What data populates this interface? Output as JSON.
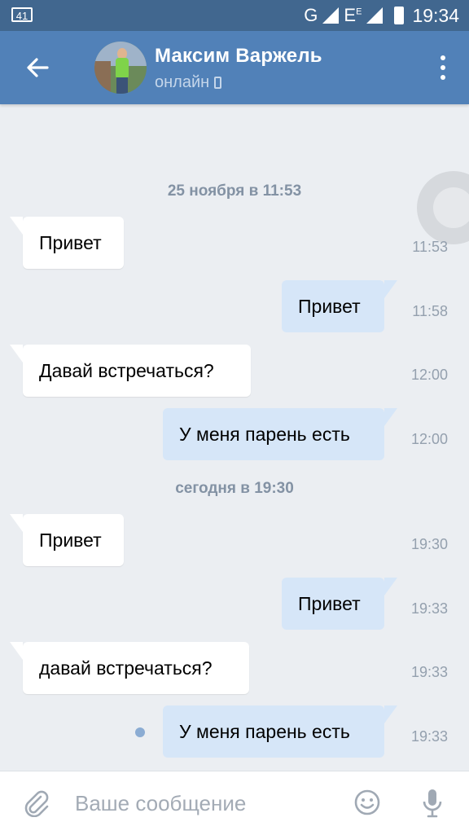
{
  "status_bar": {
    "battery_left": "41",
    "network_g": "G",
    "network_e": "E",
    "network_e_sup": "E",
    "time": "19:34"
  },
  "app_bar": {
    "contact_name": "Максим Варжель",
    "status": "онлайн",
    "back_icon": "arrow-left-icon",
    "menu_icon": "more-vertical-icon"
  },
  "conversation": {
    "date_separators": [
      "25 ноября в 11:53",
      "сегодня в 19:30"
    ],
    "messages": [
      {
        "direction": "in",
        "text": "Привет",
        "time": "11:53"
      },
      {
        "direction": "out",
        "text": "Привет",
        "time": "11:58"
      },
      {
        "direction": "in",
        "text": "Давай встречаться?",
        "time": "12:00"
      },
      {
        "direction": "out",
        "text": "У меня парень есть",
        "time": "12:00"
      },
      {
        "direction": "in",
        "text": "Привет",
        "time": "19:30"
      },
      {
        "direction": "out",
        "text": "Привет",
        "time": "19:33"
      },
      {
        "direction": "in",
        "text": "давай встречаться?",
        "time": "19:33"
      },
      {
        "direction": "out",
        "text": "У меня парень есть",
        "time": "19:33",
        "unread": true
      }
    ]
  },
  "composer": {
    "placeholder": "Ваше сообщение",
    "attach_icon": "paperclip-icon",
    "emoji_icon": "smile-icon",
    "voice_icon": "microphone-icon"
  },
  "colors": {
    "app_bar": "#5181b8",
    "status_bar": "#41678f",
    "outgoing_bubble": "#d6e6f8",
    "incoming_bubble": "#ffffff",
    "background": "#ebeef2"
  }
}
